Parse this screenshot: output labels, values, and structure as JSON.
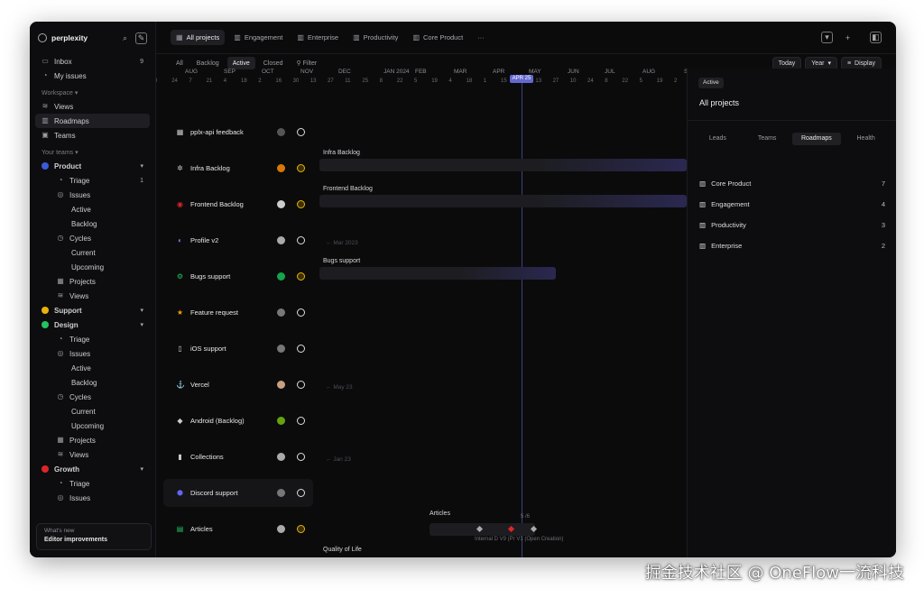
{
  "sidebar": {
    "workspace": "perplexity",
    "top": [
      {
        "label": "Inbox",
        "count": "9"
      },
      {
        "label": "My issues",
        "count": ""
      }
    ],
    "workspace_section": "Workspace",
    "workspace_items": [
      {
        "label": "Views"
      },
      {
        "label": "Roadmaps"
      },
      {
        "label": "Teams"
      }
    ],
    "teams_section": "Your teams",
    "teams": [
      {
        "label": "Product",
        "color": "#3b5bdb"
      },
      {
        "label": "Triage",
        "count": "1"
      },
      {
        "label": "Issues"
      },
      {
        "label": "Active"
      },
      {
        "label": "Backlog"
      },
      {
        "label": "Cycles"
      },
      {
        "label": "Current"
      },
      {
        "label": "Upcoming"
      },
      {
        "label": "Projects"
      },
      {
        "label": "Views"
      },
      {
        "label": "Support",
        "color": "#eab308"
      },
      {
        "label": "Design",
        "color": "#22c55e"
      },
      {
        "label": "Triage"
      },
      {
        "label": "Issues"
      },
      {
        "label": "Active"
      },
      {
        "label": "Backlog"
      },
      {
        "label": "Cycles"
      },
      {
        "label": "Current"
      },
      {
        "label": "Upcoming"
      },
      {
        "label": "Projects"
      },
      {
        "label": "Views"
      },
      {
        "label": "Growth",
        "color": "#dc2626"
      },
      {
        "label": "Triage"
      },
      {
        "label": "Issues"
      }
    ],
    "whats_new": {
      "label": "What's new",
      "title": "Editor improvements"
    }
  },
  "top_tabs": [
    {
      "label": "All projects",
      "selected": true
    },
    {
      "label": "Engagement"
    },
    {
      "label": "Enterprise"
    },
    {
      "label": "Productivity"
    },
    {
      "label": "Core Product"
    },
    {
      "label": "···"
    }
  ],
  "filters": [
    "All",
    "Backlog",
    "Active",
    "Closed"
  ],
  "filter_button": "Filter",
  "right_buttons": {
    "today": "Today",
    "year": "Year",
    "display": "Display"
  },
  "timeline": {
    "months": [
      "AUG",
      "SEP",
      "OCT",
      "NOV",
      "DEC",
      "JAN 2024",
      "FEB",
      "MAR",
      "APR",
      "MAY",
      "JUN",
      "JUL",
      "AUG",
      "S"
    ],
    "days": [
      "0",
      "24",
      "7",
      "21",
      "4",
      "18",
      "2",
      "16",
      "30",
      "13",
      "27",
      "11",
      "25",
      "8",
      "22",
      "5",
      "19",
      "4",
      "18",
      "1",
      "15",
      "29",
      "13",
      "27",
      "10",
      "24",
      "8",
      "22",
      "5",
      "19",
      "2",
      "1"
    ],
    "today_label": "APR 25"
  },
  "projects": [
    {
      "name": "pplx-api feedback",
      "icon": "▦",
      "iconColor": "#ccc",
      "av": "#555",
      "status": "w"
    },
    {
      "name": "Infra Backlog",
      "icon": "✲",
      "iconColor": "#ccc",
      "av": "#d97706",
      "status": "y"
    },
    {
      "name": "Frontend Backlog",
      "icon": "◉",
      "iconColor": "#dc2626",
      "av": "#ccc",
      "status": "y"
    },
    {
      "name": "Profile v2",
      "icon": "◐",
      "iconColor": "#8b7cf6",
      "av": "#aaa",
      "status": "w"
    },
    {
      "name": "Bugs support",
      "icon": "⚙",
      "iconColor": "#22c55e",
      "av": "#16a34a",
      "status": "y"
    },
    {
      "name": "Feature request",
      "icon": "★",
      "iconColor": "#f59e0b",
      "av": "#777",
      "status": "w"
    },
    {
      "name": "iOS support",
      "icon": "▯",
      "iconColor": "#ccc",
      "av": "#777",
      "status": "w"
    },
    {
      "name": "Vercel",
      "icon": "⚓",
      "iconColor": "#ccc",
      "av": "#c8a080",
      "status": "w"
    },
    {
      "name": "Android (Backlog)",
      "icon": "◆",
      "iconColor": "#ccc",
      "av": "#65a30d",
      "status": "w"
    },
    {
      "name": "Collections",
      "icon": "▮",
      "iconColor": "#ccc",
      "av": "#aaa",
      "status": "w"
    },
    {
      "name": "Discord support",
      "icon": "⬢",
      "iconColor": "#6366f1",
      "av": "#777",
      "status": "w"
    },
    {
      "name": "Articles",
      "icon": "▤",
      "iconColor": "#22c55e",
      "av": "#aaa",
      "status": "y"
    },
    {
      "name": "Quality of Life",
      "icon": "▣",
      "iconColor": "#eab308",
      "av": "#c8a080",
      "status": "y"
    }
  ],
  "bars": [
    {
      "label": "Infra Backlog"
    },
    {
      "label": "Frontend Backlog"
    },
    {
      "label": "Bugs support"
    },
    {
      "label": "Articles"
    },
    {
      "label": "Quality of Life"
    }
  ],
  "arrows": [
    "Mar 2023",
    "May 23",
    "Jan 23"
  ],
  "milestones": {
    "text": "Internal D  V9 (Pr  V1 (Open Creation)",
    "count": "5 /6"
  },
  "right_panel": {
    "badge": "Active",
    "title": "All projects",
    "tabs": [
      "Leads",
      "Teams",
      "Roadmaps",
      "Health"
    ],
    "items": [
      {
        "label": "Core Product",
        "count": "7"
      },
      {
        "label": "Engagement",
        "count": "4"
      },
      {
        "label": "Productivity",
        "count": "3"
      },
      {
        "label": "Enterprise",
        "count": "2"
      }
    ]
  },
  "watermark": "掘金技术社区 @ OneFlow一流科技"
}
